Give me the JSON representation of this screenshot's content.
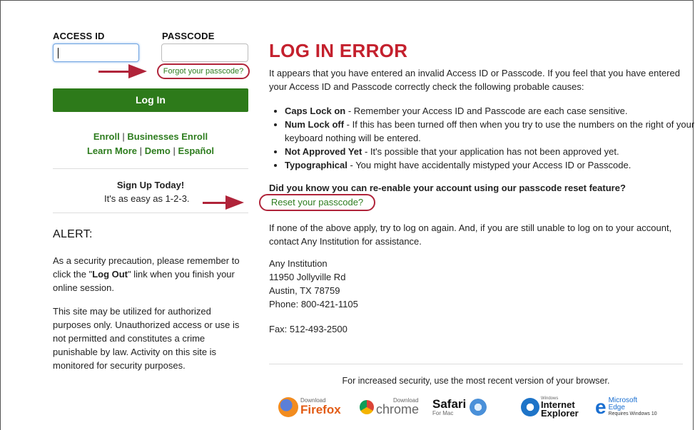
{
  "login": {
    "access_id_label": "ACCESS ID",
    "passcode_label": "PASSCODE",
    "forgot_link": "Forgot your passcode?",
    "login_button": "Log In"
  },
  "enroll_links": {
    "enroll": "Enroll",
    "businesses_enroll": "Businesses Enroll",
    "learn_more": "Learn More",
    "demo": "Demo",
    "espanol": "Español",
    "separator": "|"
  },
  "signup": {
    "title": "Sign Up Today!",
    "text": "It's as easy as 1-2-3."
  },
  "alert": {
    "title": "ALERT:",
    "para1_pre": "As a security precaution, please remember to click the \"",
    "para1_bold": "Log Out",
    "para1_post": "\" link when you finish your online session.",
    "para2": "This site may be utilized for authorized purposes only. Unauthorized access or use is not permitted and constitutes a crime punishable by law. Activity on this site is monitored for security purposes."
  },
  "error": {
    "title": "LOG IN ERROR",
    "intro": "It appears that you have entered an invalid Access ID or Passcode. If you feel that you have entered your Access ID and Passcode correctly check the following probable causes:",
    "causes": [
      {
        "term": "Caps Lock on",
        "desc": " - Remember your Access ID and Passcode are each case sensitive."
      },
      {
        "term": "Num Lock off",
        "desc": " - If this has been turned off then when you try to use the numbers on the right of your keyboard nothing will be entered."
      },
      {
        "term": "Not Approved Yet",
        "desc": " - It's possible that your application has not been approved yet."
      },
      {
        "term": "Typographical",
        "desc": " - You might have accidentally mistyped your Access ID or Passcode."
      }
    ],
    "reenable_question": "Did you know you can re-enable your account using our passcode reset feature?",
    "reset_link": "Reset your passcode?",
    "none_apply": "If none of the above apply, try to log on again. And, if you are still unable to log on to your account, contact Any Institution for assistance."
  },
  "contact": {
    "name": "Any Institution",
    "street": "11950 Jollyville Rd",
    "city": "Austin, TX 78759",
    "phone": "Phone: 800-421-1105",
    "fax": "Fax: 512-493-2500"
  },
  "browsers": {
    "note": "For increased security, use the most recent version of your browser.",
    "firefox": {
      "small": "Download",
      "name": "Firefox"
    },
    "chrome": {
      "small": "Download",
      "name": "chrome"
    },
    "safari": {
      "name": "Safari",
      "small": "For Mac"
    },
    "ie": {
      "small": "Windows",
      "name1": "Internet",
      "name2": "Explorer"
    },
    "edge": {
      "name1": "Microsoft",
      "name2": "Edge",
      "small": "Requires Windows 10"
    }
  },
  "colors": {
    "accent_green": "#2d7a1a",
    "error_red": "#c4202d",
    "annotation_red": "#b0243a"
  }
}
